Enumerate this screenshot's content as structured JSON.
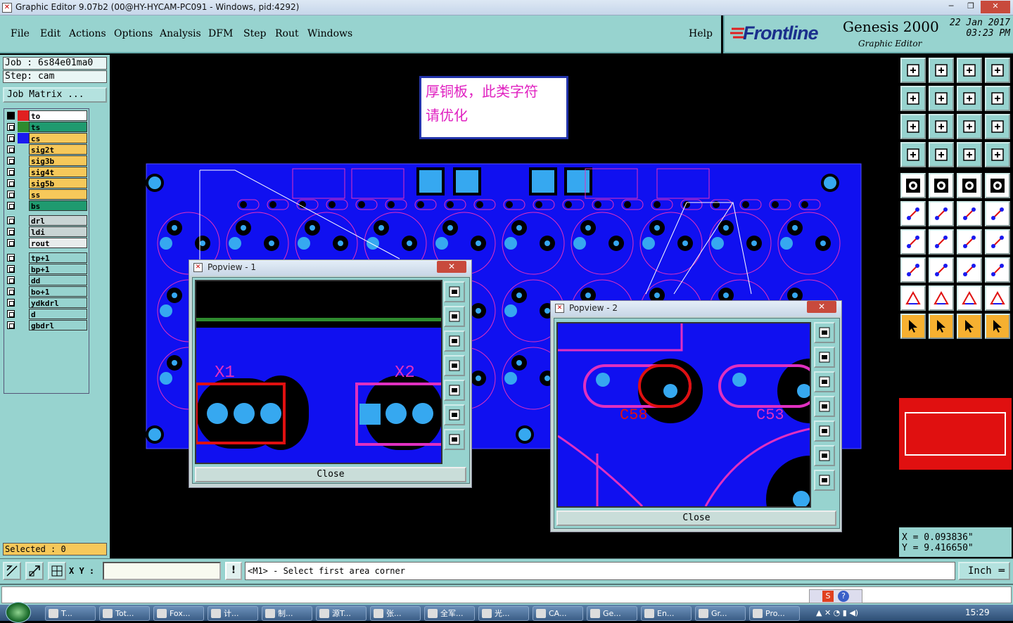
{
  "window": {
    "title": "Graphic Editor 9.07b2 (00@HY-HYCAM-PC091 - Windows, pid:4292)",
    "min": "─",
    "max": "❐",
    "close": "✕"
  },
  "menu": [
    "File",
    "Edit",
    "Actions",
    "Options",
    "Analysis",
    "DFM",
    "Step",
    "Rout",
    "Windows"
  ],
  "help": "Help",
  "brand": {
    "frontline": "Frontline",
    "product": "Genesis 2000",
    "subtitle": "Graphic Editor",
    "date": "22 Jan 2017",
    "time": "03:23 PM"
  },
  "job": {
    "job_line": "Job : 6s84e01ma0",
    "step_line": "Step: cam",
    "matrix_button": "Job Matrix ..."
  },
  "layers": [
    {
      "name": "to",
      "color": "#ffffff",
      "swatch": "#e02020",
      "active": true
    },
    {
      "name": "ts",
      "color": "#1f9a6f",
      "swatch": "#2e8b2e"
    },
    {
      "name": "cs",
      "color": "#f6c85a",
      "swatch": "#1a1af0"
    },
    {
      "name": "sig2t",
      "color": "#f6c85a"
    },
    {
      "name": "sig3b",
      "color": "#f6c85a"
    },
    {
      "name": "sig4t",
      "color": "#f6c85a"
    },
    {
      "name": "sig5b",
      "color": "#f6c85a"
    },
    {
      "name": "ss",
      "color": "#f6c85a"
    },
    {
      "name": "bs",
      "color": "#1f9a6f"
    },
    {
      "name": "drl",
      "color": "#c8d4d4",
      "gap": true
    },
    {
      "name": "ldi",
      "color": "#c8d4d4"
    },
    {
      "name": "rout",
      "color": "#e8ecec"
    },
    {
      "name": "tp+1",
      "color": "#97d3cf",
      "gap": true
    },
    {
      "name": "bp+1",
      "color": "#97d3cf"
    },
    {
      "name": "dd",
      "color": "#97d3cf"
    },
    {
      "name": "bo+1",
      "color": "#97d3cf"
    },
    {
      "name": "ydkdrl",
      "color": "#97d3cf"
    },
    {
      "name": "d",
      "color": "#97d3cf"
    },
    {
      "name": "gbdrl",
      "color": "#97d3cf"
    }
  ],
  "selected": "Selected : 0",
  "note": {
    "line1": "厚铜板，此类字符",
    "line2": "请优化"
  },
  "popview1": {
    "title": "Popview - 1",
    "close_label": "Close",
    "label_a": "X1",
    "label_b": "X2"
  },
  "popview2": {
    "title": "Popview - 2",
    "close_label": "Close",
    "label_a": "C58",
    "label_b": "C53"
  },
  "coords": {
    "x": "X = 0.093836\"",
    "y": "Y = 9.416650\""
  },
  "cmd": {
    "xy_label": "X Y :",
    "warn": "!",
    "prompt": "<M1> - Select first area corner",
    "units": "Inch"
  },
  "taskbar": {
    "items": [
      "T...",
      "Tot...",
      "Fox...",
      "计...",
      "制...",
      "源T...",
      "张...",
      "全军...",
      "光...",
      "CA...",
      "Ge...",
      "En...",
      "Gr...",
      "Pro..."
    ],
    "clock": "15:29"
  },
  "colors": {
    "teal": "#97d3cf",
    "board": "#1010f0",
    "pad_pink": "#e030c0",
    "accent_red": "#e01010"
  }
}
